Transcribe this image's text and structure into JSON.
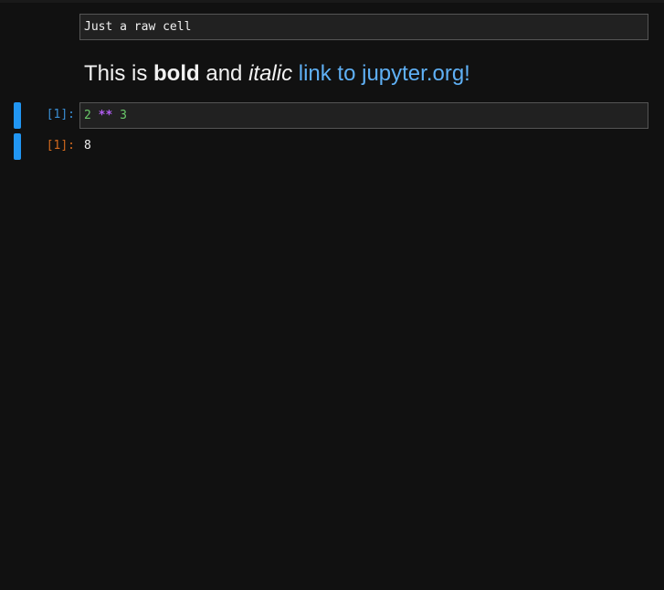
{
  "raw_cell": {
    "text": "Just a raw cell"
  },
  "markdown_cell": {
    "prefix": "This is ",
    "bold": "bold",
    "middle": " and ",
    "italic": "italic",
    "space": " ",
    "link_text": "link to jupyter.org!"
  },
  "code_cell": {
    "prompt": "[1]:",
    "tokens": {
      "a": "2",
      "op": "**",
      "b": "3"
    }
  },
  "output_cell": {
    "prompt": "[1]:",
    "text": "8"
  },
  "colors": {
    "background": "#111111",
    "editor_bg": "#212121",
    "collapser": "#2196f3",
    "input_prompt": "#3a8fd6",
    "output_prompt": "#d2691e",
    "link": "#5fb0f5",
    "number": "#6ac96a",
    "operator": "#b05cf0"
  }
}
